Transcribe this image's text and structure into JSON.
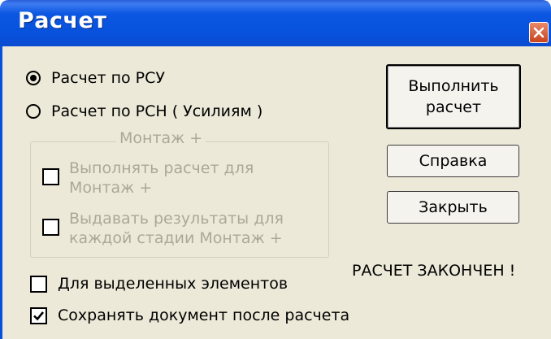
{
  "window": {
    "title": "Расчет"
  },
  "options": {
    "radio_rsu": {
      "label": "Расчет по РСУ",
      "checked": true
    },
    "radio_rsn": {
      "label": "Расчет по РСН ( Усилиям )",
      "checked": false
    }
  },
  "montage_group": {
    "label": "Монтаж +",
    "perform_line1": "Выполнять расчет для",
    "perform_line2": "Монтаж +",
    "output_line1": "Выдавать результаты для",
    "output_line2": "каждой стадии Монтаж +"
  },
  "checkboxes": {
    "selected_elements": {
      "label": "Для выделенных элементов",
      "checked": false
    },
    "save_document": {
      "label": "Сохранять документ после расчета",
      "checked": true
    }
  },
  "buttons": {
    "run_line1": "Выполнить",
    "run_line2": "расчет",
    "help": "Справка",
    "close": "Закрыть"
  },
  "status": {
    "text": "РАСЧЕТ ЗАКОНЧЕН !"
  }
}
